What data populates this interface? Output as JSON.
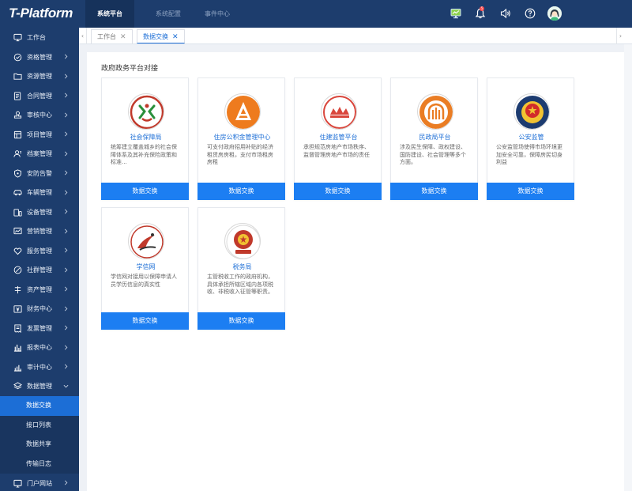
{
  "app": {
    "logo": "T-Platform"
  },
  "topnav": [
    "系统平台",
    "系统配置",
    "事件中心"
  ],
  "topicons": {
    "monitor": "monitor-icon",
    "bell": "bell-icon",
    "badge": "5",
    "volume": "volume-icon",
    "help": "help-icon"
  },
  "sidebar": {
    "items": [
      {
        "label": "工作台",
        "icon": "monitor-icon"
      },
      {
        "label": "资格管理",
        "icon": "check-circle-icon"
      },
      {
        "label": "资源管理",
        "icon": "folder-icon"
      },
      {
        "label": "合同管理",
        "icon": "contract-icon"
      },
      {
        "label": "审核中心",
        "icon": "stamp-icon"
      },
      {
        "label": "项目管理",
        "icon": "project-icon"
      },
      {
        "label": "档案管理",
        "icon": "user-file-icon"
      },
      {
        "label": "安防告警",
        "icon": "shield-icon"
      },
      {
        "label": "车辆管理",
        "icon": "car-icon"
      },
      {
        "label": "设备管理",
        "icon": "device-icon"
      },
      {
        "label": "营销管理",
        "icon": "chart-icon"
      },
      {
        "label": "服务管理",
        "icon": "heart-icon"
      },
      {
        "label": "社群管理",
        "icon": "community-icon"
      },
      {
        "label": "资产管理",
        "icon": "asset-icon"
      },
      {
        "label": "财务中心",
        "icon": "finance-icon"
      },
      {
        "label": "发票管理",
        "icon": "invoice-icon"
      },
      {
        "label": "报表中心",
        "icon": "bar-chart-icon"
      },
      {
        "label": "审计中心",
        "icon": "audit-icon"
      },
      {
        "label": "数据管理",
        "icon": "database-icon"
      }
    ],
    "subitems": [
      "数据交换",
      "接口列表",
      "数据共享",
      "传输日志"
    ],
    "bottom": {
      "label": "门户网站",
      "icon": "portal-icon"
    }
  },
  "tabs": [
    {
      "label": "工作台"
    },
    {
      "label": "数据交换"
    }
  ],
  "section_title": "政府政务平台对接",
  "colors": {
    "sidebar": "#1d3d6d",
    "accent": "#1c7ef2",
    "active_sub": "#1c6ed6"
  },
  "cards": [
    {
      "name": "社会保障局",
      "desc": "统筹建立覆盖城乡的社会保障体系及其补充保险政策和标准...",
      "button": "数据交换",
      "logo": "social-security-logo"
    },
    {
      "name": "住房公积金管理中心",
      "desc": "可支付政府招用补贴的经济租赁房房租，支付市场租房房租",
      "button": "数据交换",
      "logo": "housing-fund-logo"
    },
    {
      "name": "住建监管平台",
      "desc": "承担规范房地产市场秩序、监督管理房地产市场的责任",
      "button": "数据交换",
      "logo": "housing-construction-logo"
    },
    {
      "name": "民政局平台",
      "desc": "涉及民生保障、政权建设、国防建设、社会管理等多个方面。",
      "button": "数据交换",
      "logo": "civil-affairs-logo"
    },
    {
      "name": "公安监管",
      "desc": "公安监管场使得市场环境更加安全可靠，保障房民切身利益",
      "button": "数据交换",
      "logo": "police-logo"
    },
    {
      "name": "学信网",
      "desc": "学信网对接用以保障申请人员学历信息的真实性",
      "button": "数据交换",
      "logo": "chsi-logo"
    },
    {
      "name": "税务局",
      "desc": "主管税收工作的政府机构，具体承担所辖区域内各项税收、非税收入征管等职责。",
      "button": "数据交换",
      "logo": "tax-bureau-logo"
    }
  ]
}
